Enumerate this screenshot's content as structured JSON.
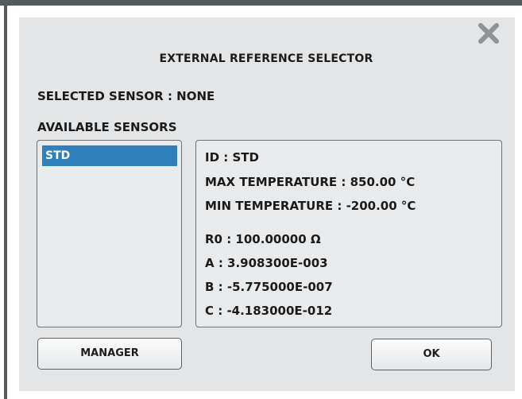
{
  "dialog": {
    "title": "EXTERNAL REFERENCE SELECTOR",
    "close_icon": "close-x-icon",
    "selected_sensor_text": "SELECTED SENSOR : NONE",
    "available_sensors_label": "AVAILABLE SENSORS"
  },
  "sensors": {
    "items": [
      {
        "label": "STD",
        "selected": true
      }
    ],
    "selection_color": "#2f7fbc"
  },
  "details": {
    "id": "ID : STD",
    "max_temperature": "MAX TEMPERATURE : 850.00 °C",
    "min_temperature": "MIN TEMPERATURE : -200.00 °C",
    "r0": "R0 : 100.00000 Ω",
    "a": "A : 3.908300E-003",
    "b": "B : -5.775000E-007",
    "c": "C : -4.183000E-012"
  },
  "buttons": {
    "manager_label": "MANAGER",
    "ok_label": "OK"
  }
}
